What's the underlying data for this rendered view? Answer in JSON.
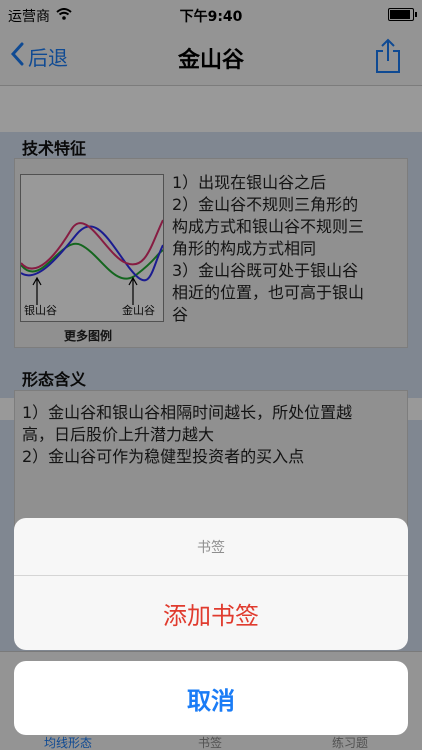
{
  "status_bar": {
    "carrier": "运营商",
    "time": "下午9:40",
    "battery_level": 0.9
  },
  "nav": {
    "back_label": "后退",
    "title": "金山谷"
  },
  "technical_features": {
    "heading": "技术特征",
    "chart_labels": {
      "left": "银山谷",
      "right": "金山谷"
    },
    "more_examples": "更多图例",
    "lines": [
      "1）出现在银山谷之后",
      "2）金山谷不规则三角形的",
      "构成方式和银山谷不规则三",
      "角形的构成方式相同",
      "3）金山谷既可处于银山谷",
      "相近的位置，也可高于银山",
      "谷"
    ]
  },
  "pattern_meaning": {
    "heading": "形态含义",
    "lines": [
      "1）金山谷和银山谷相隔时间越长，所处位置越",
      "高，日后股价上升潜力越大",
      "2）金山谷可作为稳健型投资者的买入点"
    ]
  },
  "tabs": [
    {
      "label": "均线形态",
      "active": true
    },
    {
      "label": "书签",
      "active": false
    },
    {
      "label": "练习题",
      "active": false
    }
  ],
  "action_sheet": {
    "title": "书签",
    "action": "添加书签",
    "cancel": "取消"
  },
  "colors": {
    "accent": "#1a7cf6",
    "destructive": "#e03b2e",
    "line_red": "#e0306e",
    "line_blue": "#2d2ff0",
    "line_green": "#22aa33"
  }
}
